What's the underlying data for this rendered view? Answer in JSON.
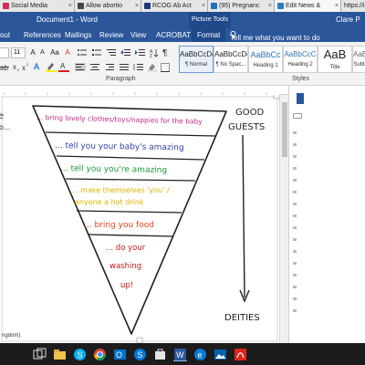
{
  "browser": {
    "tabs": [
      {
        "label": "Social Media",
        "color": "#cc2f5a"
      },
      {
        "label": "Allow abortio",
        "color": "#444444"
      },
      {
        "label": "RCOG Ab Act",
        "color": "#1a3a7a"
      },
      {
        "label": "(95) Pregnanc",
        "color": "#1e73be"
      },
      {
        "label": "Edit News &",
        "color": "#2a7fbf"
      },
      {
        "label": "https://i.sta",
        "color": "#888888"
      }
    ],
    "close_glyph": "×"
  },
  "word": {
    "title": "Document1 - Word",
    "picture_tools": "Picture Tools",
    "user": "Clare P",
    "ribbon_tabs": [
      "out",
      "References",
      "Mailings",
      "Review",
      "View",
      "ACROBAT",
      "Format"
    ],
    "tell_me": "Tell me what you want to do",
    "font": {
      "size": "11",
      "grow": "A",
      "shrink": "A",
      "case": "Aa",
      "clear": "A"
    },
    "paragraph_label": "Paragraph",
    "styles_label": "Styles",
    "styles": [
      {
        "sample": "AaBbCcDc",
        "name": "¶ Normal"
      },
      {
        "sample": "AaBbCcDc",
        "name": "¶ No Spac..."
      },
      {
        "sample": "AaBbCc",
        "name": "Heading 1"
      },
      {
        "sample": "AaBbCcC",
        "name": "Heading 2"
      },
      {
        "sample": "AaB",
        "name": "Title"
      },
      {
        "sample": "AaBbC",
        "name": "Subt"
      }
    ],
    "status_text": "ngdom)"
  },
  "drawing": {
    "left_fragments": [
      "e",
      "o..."
    ],
    "lines": [
      {
        "text": "... bring lovely clothes/toys/nappies for the baby",
        "color": "#c62a8a"
      },
      {
        "text": "... tell you your baby's amazing",
        "color": "#3340a8"
      },
      {
        "text": "... tell you you're amazing",
        "color": "#1f9a3a"
      },
      {
        "text": "... make themselves 'you' / anyone a hot drink",
        "color": "#e0b300"
      },
      {
        "text": "... bring you food",
        "color": "#e0451c"
      },
      {
        "text": "... do your washing up!",
        "color": "#c01a1a"
      }
    ],
    "right_top": [
      "GOOD",
      "GUESTS"
    ],
    "right_bottom": "DEITIES"
  },
  "taskbar": [
    "start",
    "cortana",
    "task-view",
    "chrome",
    "outlook",
    "skype",
    "explorer",
    "word",
    "edge",
    "photos",
    "acrobat"
  ]
}
